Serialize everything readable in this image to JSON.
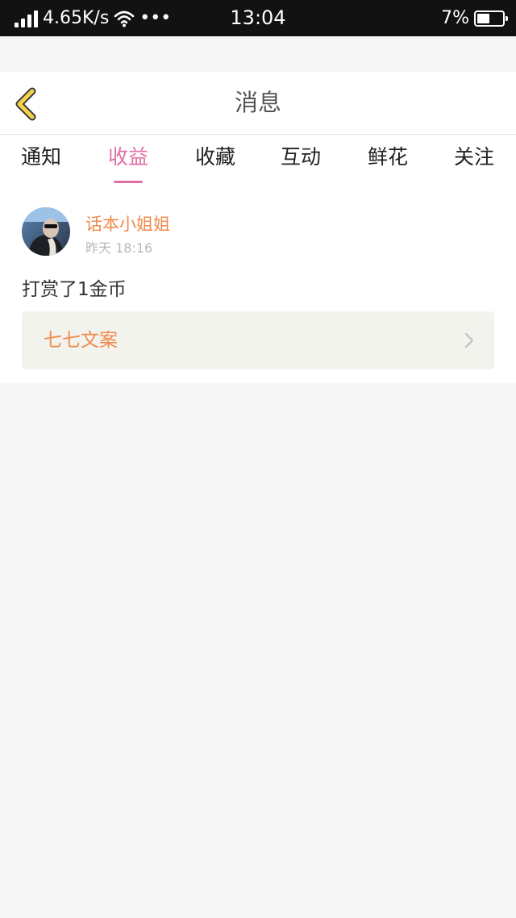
{
  "status_bar": {
    "network_speed": "4.65K/s",
    "dots": "•••",
    "time": "13:04",
    "battery_percent": "7%",
    "battery_level": 0.5
  },
  "header": {
    "title": "消息",
    "back_icon": "chevron-left-icon"
  },
  "tabs": [
    {
      "label": "通知",
      "active": false
    },
    {
      "label": "收益",
      "active": true
    },
    {
      "label": "收藏",
      "active": false
    },
    {
      "label": "互动",
      "active": false
    },
    {
      "label": "鲜花",
      "active": false
    },
    {
      "label": "关注",
      "active": false
    }
  ],
  "message": {
    "username": "话本小姐姐",
    "time": "昨天 18:16",
    "content": "打赏了1金币",
    "link_label": "七七文案",
    "link_icon": "chevron-right-icon"
  },
  "colors": {
    "accent_pink": "#e06fa6",
    "accent_orange": "#f08a4b",
    "back_icon_yellow": "#f5d24a"
  }
}
